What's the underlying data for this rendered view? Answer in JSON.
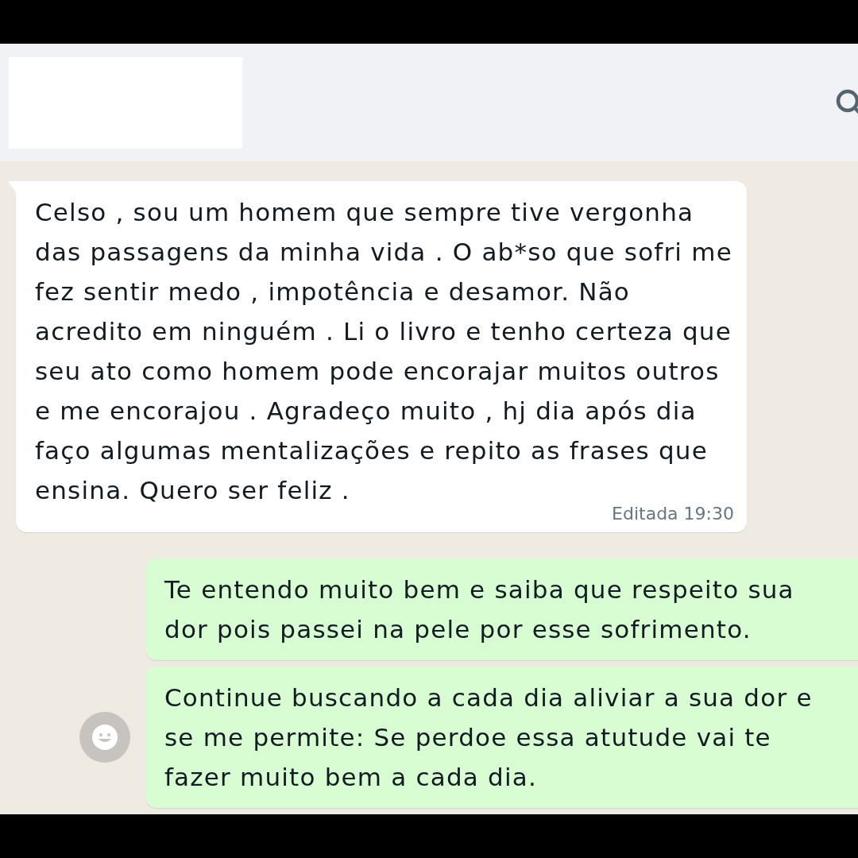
{
  "messages": [
    {
      "kind": "incoming",
      "text": "Celso , sou um homem que sempre tive vergonha das passagens da minha vida . O ab*so que sofri me fez sentir medo , impotência e desamor. Não acredito em ninguém . Li o livro e tenho certeza que seu ato como homem pode encorajar muitos outros e me encorajou . Agradeço muito , hj dia após dia faço algumas mentalizações e repito as frases que ensina. Quero ser feliz .",
      "meta": "Editada 19:30"
    },
    {
      "kind": "outgoing",
      "text": "Te entendo muito bem e saiba que respeito sua dor pois passei na pele por esse sofrimento."
    },
    {
      "kind": "outgoing",
      "text": "Continue buscando a cada dia aliviar a sua dor e se me permite: Se perdoe essa atutude vai te fazer muito bem a cada dia.",
      "reaction_button": true
    }
  ]
}
